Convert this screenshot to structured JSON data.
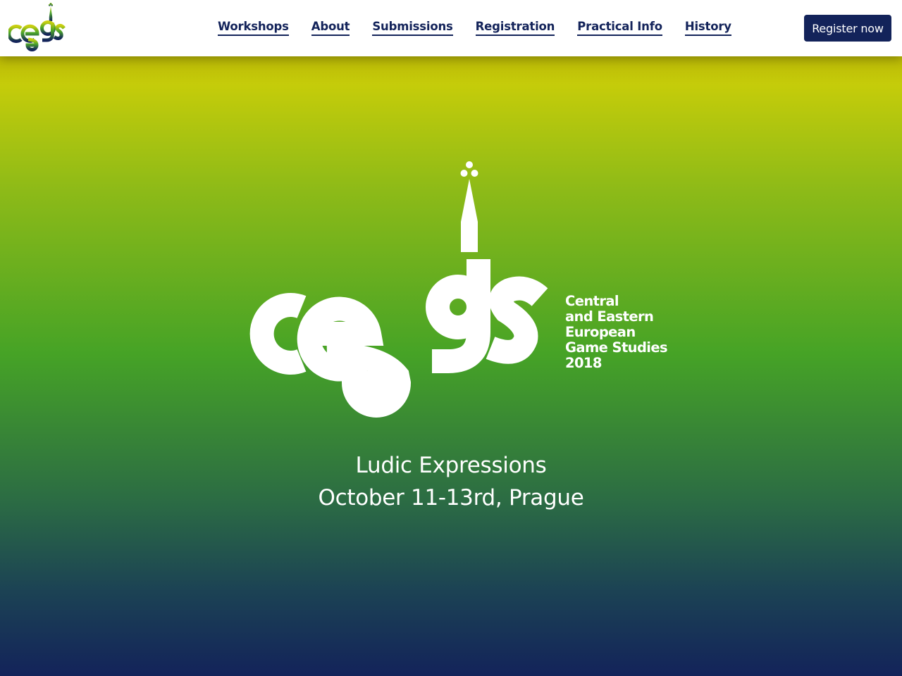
{
  "brand": {
    "logo_text": "ceəgs",
    "colors": {
      "navy": "#13235a",
      "green": "#46a326",
      "yellow_green": "#d4d106"
    }
  },
  "nav": {
    "items": [
      {
        "label": "Workshops"
      },
      {
        "label": "About"
      },
      {
        "label": "Submissions"
      },
      {
        "label": "Registration"
      },
      {
        "label": "Practical Info"
      },
      {
        "label": "History"
      }
    ],
    "cta_label": "Register now"
  },
  "hero": {
    "logo_text": "ceəgs",
    "tagline": [
      "Central",
      "and Eastern",
      "European",
      "Game Studies",
      "2018"
    ],
    "title": "Ludic Expressions",
    "date_location": "October 11-13rd, Prague"
  }
}
